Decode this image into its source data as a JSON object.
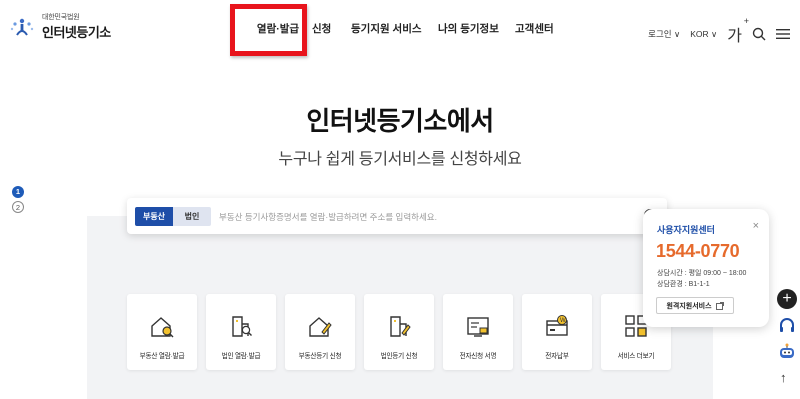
{
  "logo": {
    "sub": "대한민국법원",
    "main": "인터넷등기소"
  },
  "nav": {
    "items": [
      "열람·발급",
      "신청",
      "등기지원 서비스",
      "나의 등기정보",
      "고객센터"
    ]
  },
  "util": {
    "login": "로그인",
    "lang": "KOR",
    "font_size": "가",
    "font_sup": "+"
  },
  "hero": {
    "title": "인터넷등기소에서",
    "subtitle": "누구나 쉽게 등기서비스를 신청하세요"
  },
  "pager": [
    "1",
    "2"
  ],
  "search": {
    "tab_active": "부동산",
    "tab_inactive": "법인",
    "placeholder": "부동산 등기사항증명서를 열람·발급하려면 주소를 입력하세요."
  },
  "cards": [
    {
      "label": "부동산 열람·발급",
      "icon": "house-search-icon"
    },
    {
      "label": "법인 열람·발급",
      "icon": "building-search-icon"
    },
    {
      "label": "부동산등기 신청",
      "icon": "house-edit-icon"
    },
    {
      "label": "법인등기 신청",
      "icon": "building-edit-icon"
    },
    {
      "label": "전자신청 서명",
      "icon": "signature-icon"
    },
    {
      "label": "전자납부",
      "icon": "payment-icon"
    },
    {
      "label": "서비스 더보기",
      "icon": "grid-more-icon"
    }
  ],
  "help": {
    "title": "사용자지원센터",
    "phone": "1544-0770",
    "hours": "상담시간 : 평일 09:00 ~ 18:00",
    "env": "상담환경 : B1-1-1",
    "remote_btn": "원격지원서비스"
  },
  "colors": {
    "accent": "#1e4ea8",
    "phone": "#e66a2c",
    "highlight": "#e8141c"
  }
}
